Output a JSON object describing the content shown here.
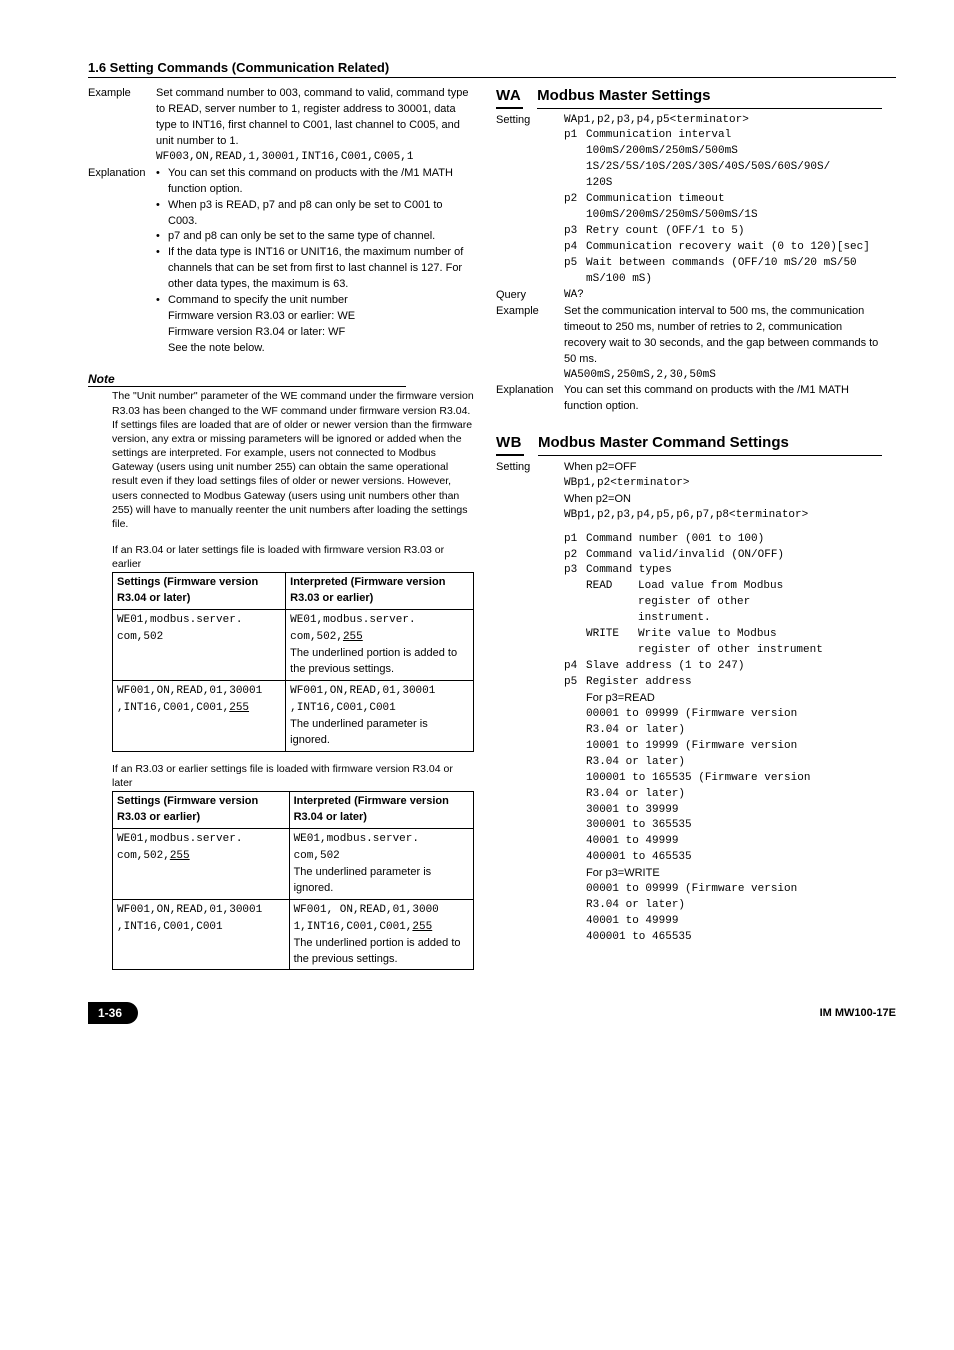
{
  "heading": "1.6  Setting Commands (Communication Related)",
  "left": {
    "example_label": "Example",
    "example_text": "Set command number to 003, command to valid, command type to READ, server number to 1, register address to 30001, data type to INT16, first channel to C001, last channel to C005, and unit number to 1.",
    "example_cmd": "WF003,ON,READ,1,30001,INT16,C001,C005,1",
    "explanation_label": "Explanation",
    "bullets": [
      "You can set this command on products with the /M1 MATH function option.",
      "When p3 is READ, p7 and p8 can only be set to C001 to C003.",
      "p7 and p8 can only be set to the same type of channel.",
      "If the data type is INT16 or UNIT16, the maximum number of channels that can be set from first to last channel is 127. For other data types, the maximum is 63.",
      "Command to specify the unit number"
    ],
    "bullet5_lines": [
      "Firmware version R3.03 or earlier: WE",
      "Firmware version R3.04 or later: WF",
      "See the note below."
    ],
    "note_heading": "Note",
    "note_body": "The \"Unit number\" parameter of the WE command under the firmware version R3.03 has been changed to the WF command under firmware version R3.04. If settings files are loaded that are of older or newer version than the firmware version, any extra or missing parameters will be ignored or added when the settings are interpreted. For example, users not connected to Modbus Gateway (users using unit number 255) can obtain the same operational result even if they load settings files of older or newer versions. However, users connected to Modbus Gateway (users using unit numbers other than 255) will have to manually reenter the unit numbers after loading the settings file.",
    "table1_intro": "If an R3.04 or later settings file is loaded with firmware version R3.03 or earlier",
    "table1": {
      "h1": "Settings (Firmware version R3.04 or later)",
      "h2": "Interpreted (Firmware version R3.03 or earlier)",
      "r1c1a": "WE01,modbus.server.",
      "r1c1b": "com,502",
      "r1c2a": "WE01,modbus.server.",
      "r1c2b_pre": "com,502,",
      "r1c2b_u": "255",
      "r1c2_note": "The underlined portion is added to the previous settings.",
      "r2c1": "WF001,ON,READ,01,30001",
      "r2c1b_pre": ",INT16,C001,C001,",
      "r2c1b_u": "255",
      "r2c2": "WF001,ON,READ,01,30001",
      "r2c2b": ",INT16,C001,C001",
      "r2c2_note": "The underlined parameter is ignored."
    },
    "table2_intro": "If an R3.03 or earlier settings file is loaded with firmware version R3.04 or later",
    "table2": {
      "h1": "Settings (Firmware version R3.03 or earlier)",
      "h2": "Interpreted (Firmware version R3.04 or later)",
      "r1c1a": "WE01,modbus.server.",
      "r1c1b_pre": "com,502,",
      "r1c1b_u": "255",
      "r1c2a": "WE01,modbus.server.",
      "r1c2b": "com,502",
      "r1c2_note": "The underlined parameter is ignored.",
      "r2c1": "WF001,ON,READ,01,30001",
      "r2c1b": ",INT16,C001,C001",
      "r2c2": "WF001,  ON,READ,01,3000",
      "r2c2b_pre": "1,INT16,C001,C001,",
      "r2c2b_u": "255",
      "r2c2_note": "The underlined portion is added to the previous settings."
    }
  },
  "right": {
    "wa_key": "WA",
    "wa_title": "Modbus Master Settings",
    "setting_label": "Setting",
    "wa_syntax": "WAp1,p2,p3,p4,p5<terminator>",
    "wa_p1": "Communication interval",
    "wa_p1_opts": [
      "100mS/200mS/250mS/500mS",
      "1S/2S/5S/10S/20S/30S/40S/50S/60S/90S/",
      "120S"
    ],
    "wa_p2": "Communication timeout",
    "wa_p2_opts": "100mS/200mS/250mS/500mS/1S",
    "wa_p3": "Retry count (OFF/1 to 5)",
    "wa_p4": "Communication recovery wait (0 to 120)[sec]",
    "wa_p5": "Wait between commands (OFF/10 mS/20 mS/50 mS/100 mS)",
    "query_label": "Query",
    "wa_query": "WA?",
    "example_label": "Example",
    "wa_example": "Set the communication interval to 500 ms, the communication timeout to 250 ms, number of retries to 2, communication recovery wait to 30 seconds, and the gap between commands to 50 ms.",
    "wa_example_cmd": "WA500mS,250mS,2,30,50mS",
    "explanation_label": "Explanation",
    "wa_explanation": "You can set this command on products with the /M1 MATH function option.",
    "wb_key": "WB",
    "wb_title": "Modbus Master Command Settings",
    "wb_off": "When p2=OFF",
    "wb_off_syntax": "WBp1,p2<terminator>",
    "wb_on": "When p2=ON",
    "wb_on_syntax": "WBp1,p2,p3,p4,p5,p6,p7,p8<terminator>",
    "wb_p1": "Command number (001 to 100)",
    "wb_p2": "Command valid/invalid (ON/OFF)",
    "wb_p3": "Command types",
    "wb_p3_read": "READ",
    "wb_p3_read_desc": [
      "Load value from Modbus",
      "register of other",
      "instrument."
    ],
    "wb_p3_write": "WRITE",
    "wb_p3_write_desc": [
      "Write value to Modbus",
      "register of other instrument"
    ],
    "wb_p4": "Slave address (1 to 247)",
    "wb_p5": "Register address",
    "wb_p5_read_head": "For p3=READ",
    "wb_p5_read": [
      "00001 to 09999 (Firmware version",
      "R3.04 or later)",
      "10001 to 19999 (Firmware version",
      "R3.04 or later)",
      "100001 to 165535 (Firmware version",
      "R3.04 or later)",
      "30001 to 39999",
      "300001 to 365535",
      "40001 to 49999",
      "400001 to 465535"
    ],
    "wb_p5_write_head": "For p3=WRITE",
    "wb_p5_write": [
      "00001 to 09999 (Firmware version",
      "R3.04 or later)",
      "40001 to 49999",
      "400001 to 465535"
    ]
  },
  "footer": {
    "page": "1-36",
    "doc": "IM MW100-17E"
  }
}
